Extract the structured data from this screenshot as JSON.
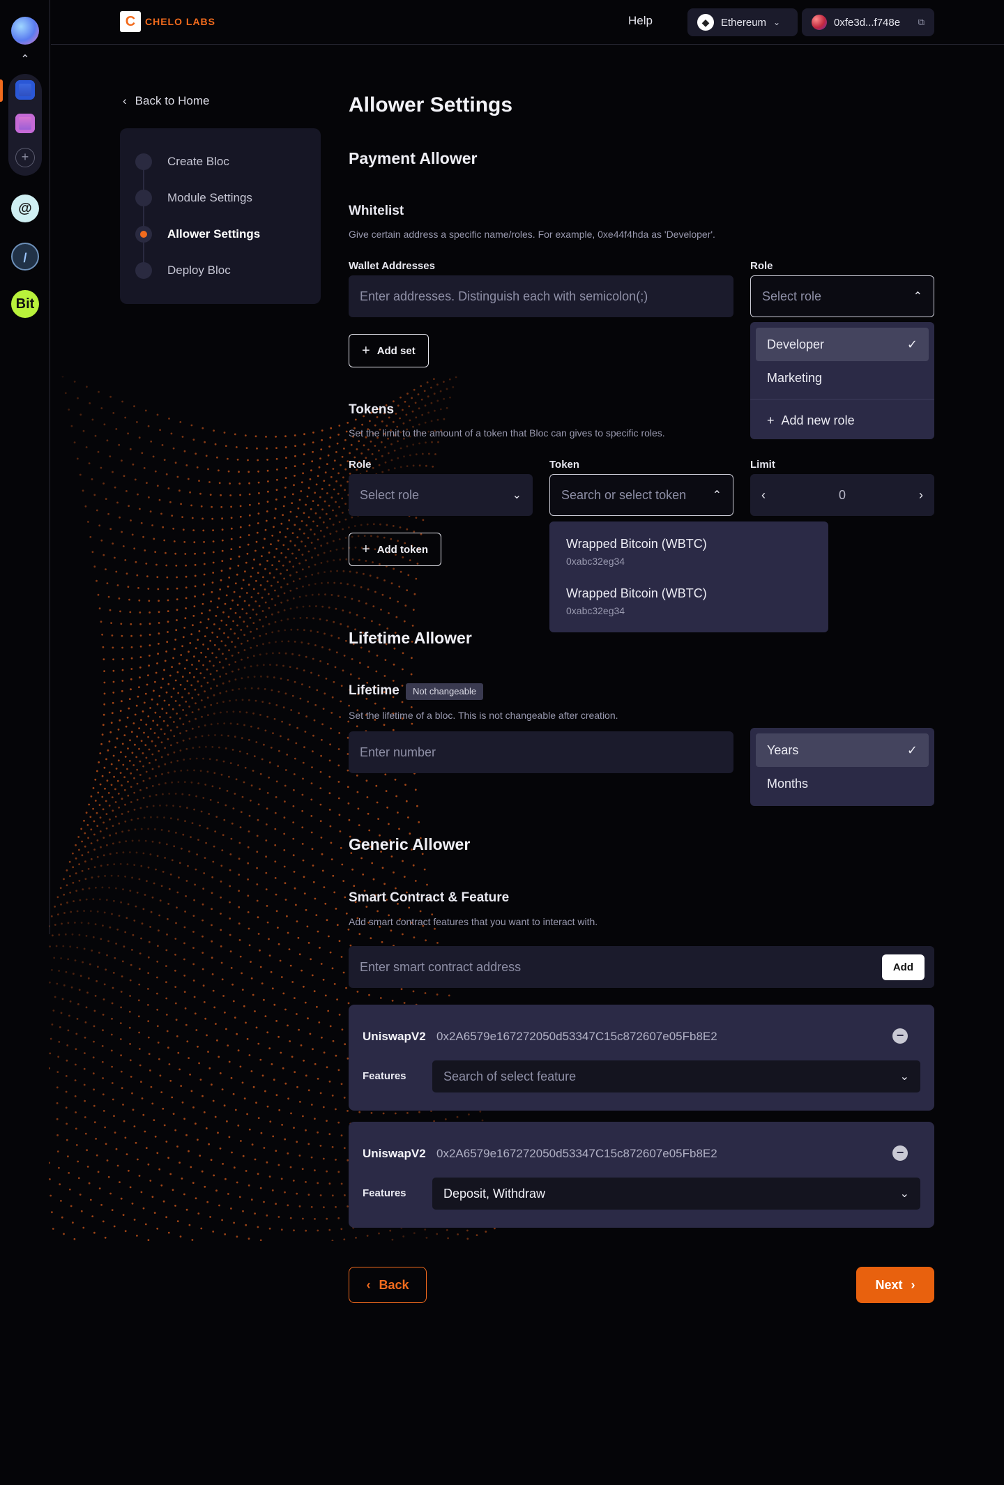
{
  "header": {
    "brand": "CHELO LABS",
    "brand_mark": "C",
    "help": "Help",
    "network": "Ethereum",
    "wallet": "0xfe3d...f748e"
  },
  "rail": {
    "apps": [
      "app-blue",
      "app-pink"
    ],
    "icons": [
      "@",
      "/",
      "Bit"
    ]
  },
  "sidebar": {
    "back": "Back to Home",
    "steps": [
      {
        "label": "Create Bloc",
        "active": false
      },
      {
        "label": "Module Settings",
        "active": false
      },
      {
        "label": "Allower Settings",
        "active": true
      },
      {
        "label": "Deploy Bloc",
        "active": false
      }
    ]
  },
  "main": {
    "title": "Allower Settings",
    "payment": {
      "heading": "Payment Allower",
      "whitelist": {
        "title": "Whitelist",
        "desc": "Give certain address a specific name/roles. For example, 0xe44f4hda as 'Developer'.",
        "wallet_label": "Wallet Addresses",
        "wallet_placeholder": "Enter addresses. Distinguish each with semicolon(;)",
        "role_label": "Role",
        "role_placeholder": "Select role",
        "add_set": "Add set",
        "role_options": [
          {
            "label": "Developer",
            "selected": true
          },
          {
            "label": "Marketing",
            "selected": false
          }
        ],
        "add_role": "Add new role"
      },
      "tokens": {
        "title": "Tokens",
        "desc": "Set the limit to the amount of a token that Bloc can gives to specific roles.",
        "role_label": "Role",
        "role_placeholder": "Select role",
        "token_label": "Token",
        "token_placeholder": "Search or select token",
        "limit_label": "Limit",
        "limit_value": "0",
        "add_token": "Add token",
        "token_options": [
          {
            "name": "Wrapped Bitcoin (WBTC)",
            "address": "0xabc32eg34"
          },
          {
            "name": "Wrapped Bitcoin (WBTC)",
            "address": "0xabc32eg34"
          }
        ]
      }
    },
    "lifetime": {
      "heading": "Lifetime Allower",
      "title": "Lifetime",
      "badge": "Not changeable",
      "desc": "Set the lifetime of a bloc. This is not changeable after creation.",
      "placeholder": "Enter number",
      "unit_options": [
        {
          "label": "Years",
          "selected": true
        },
        {
          "label": "Months",
          "selected": false
        }
      ]
    },
    "generic": {
      "heading": "Generic Allower",
      "title": "Smart Contract & Feature",
      "desc": "Add smart contract features that you want to interact with.",
      "placeholder": "Enter smart contract address",
      "add": "Add",
      "contracts": [
        {
          "name": "UniswapV2",
          "address": "0x2A6579e167272050d53347C15c872607e05Fb8E2",
          "features_label": "Features",
          "features_value": "Search of select feature",
          "is_placeholder": true
        },
        {
          "name": "UniswapV2",
          "address": "0x2A6579e167272050d53347C15c872607e05Fb8E2",
          "features_label": "Features",
          "features_value": "Deposit, Withdraw",
          "is_placeholder": false
        }
      ]
    },
    "footer": {
      "back": "Back",
      "next": "Next"
    }
  },
  "colors": {
    "accent": "#f26b1d",
    "background": "#050508",
    "panel": "#1b1b2c",
    "dropdown": "#2b2a46"
  }
}
